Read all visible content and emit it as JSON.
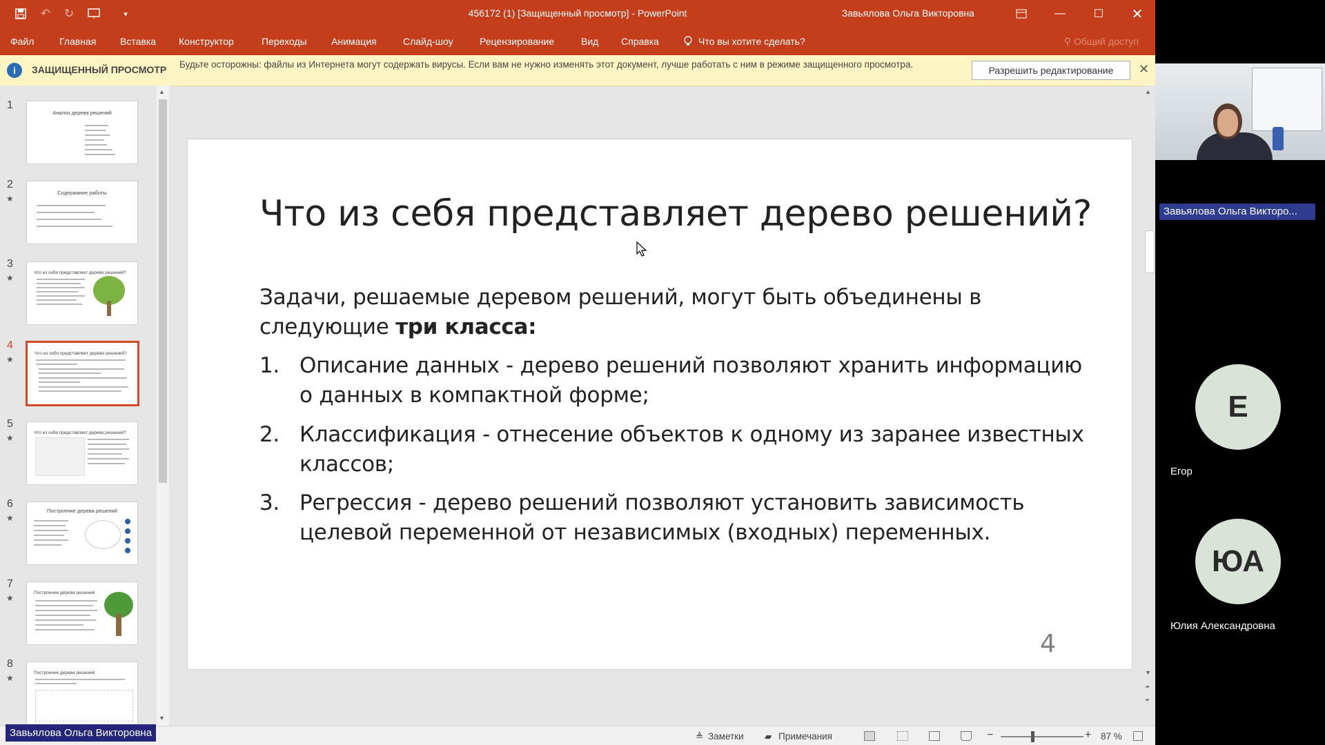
{
  "window": {
    "title": "456172 (1) [Защищенный просмотр]  -  PowerPoint",
    "user": "Завьялова Ольга Викторовна"
  },
  "menu": {
    "items": [
      "Файл",
      "Главная",
      "Вставка",
      "Конструктор",
      "Переходы",
      "Анимация",
      "Слайд-шоу",
      "Рецензирование",
      "Вид",
      "Справка"
    ],
    "tell_me": "Что вы хотите сделать?",
    "share": "Общий доступ"
  },
  "protected_view": {
    "label": "ЗАЩИЩЕННЫЙ ПРОСМОТР",
    "message": "Будьте осторожны: файлы из Интернета могут содержать вирусы. Если вам не нужно изменять этот документ, лучше работать с ним в режиме защищенного просмотра.",
    "button": "Разрешить редактирование"
  },
  "thumbnails": [
    {
      "num": "1",
      "title": "Анализ дерева решений",
      "starred": false
    },
    {
      "num": "2",
      "title": "Содержание работы",
      "starred": true
    },
    {
      "num": "3",
      "title": "Что из себя представляет дерево решений?",
      "starred": true
    },
    {
      "num": "4",
      "title": "Что из себя представляет дерево решений?",
      "starred": true,
      "selected": true
    },
    {
      "num": "5",
      "title": "Что из себя представляет дерево решений?",
      "starred": true
    },
    {
      "num": "6",
      "title": "Построение дерева решений",
      "starred": true
    },
    {
      "num": "7",
      "title": "Построение дерева решений",
      "starred": true
    },
    {
      "num": "8",
      "title": "Построение дерева решений",
      "starred": true
    }
  ],
  "slide": {
    "title": "Что из себя представляет дерево решений?",
    "intro_pre": "Задачи, решаемые деревом решений, могут быть объединены в следующие ",
    "intro_bold": "три класса:",
    "items": [
      {
        "num": "1.",
        "text": "Описание данных - дерево решений позволяют хранить информацию о данных в компактной форме;"
      },
      {
        "num": "2.",
        "text": "Классификация - отнесение объектов к одному из заранее известных классов;"
      },
      {
        "num": "3.",
        "text": "Регрессия - дерево решений позволяют установить зависимость целевой переменной от независимых (входных) переменных."
      }
    ],
    "number": "4"
  },
  "status": {
    "notes": "Заметки",
    "comments": "Примечания",
    "zoom": "87 %"
  },
  "conference": {
    "presenter_tag": "Завьялова Ольга Викторовна",
    "speaker_label": "Завьялова Ольга Викторо...",
    "participants": [
      {
        "initials": "Е",
        "name": "Егор"
      },
      {
        "initials": "ЮА",
        "name": "Юлия Александровна"
      }
    ]
  }
}
